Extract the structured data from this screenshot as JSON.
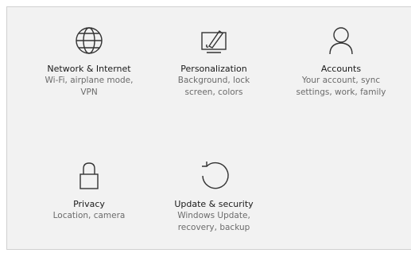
{
  "tiles": [
    {
      "title": "Network & Internet",
      "desc_line1": "Wi-Fi, airplane mode,",
      "desc_line2": "VPN",
      "icon": "globe-icon"
    },
    {
      "title": "Personalization",
      "desc_line1": "Background, lock",
      "desc_line2": "screen, colors",
      "icon": "paint-brush-icon"
    },
    {
      "title": "Accounts",
      "desc_line1": "Your account, sync",
      "desc_line2": "settings, work, family",
      "icon": "person-icon"
    },
    {
      "title": "Privacy",
      "desc_line1": "Location, camera",
      "desc_line2": "",
      "icon": "lock-icon"
    },
    {
      "title": "Update & security",
      "desc_line1": "Windows Update,",
      "desc_line2": "recovery, backup",
      "icon": "refresh-icon"
    }
  ],
  "colors": {
    "background": "#f2f2f2",
    "title": "#1a1a1a",
    "desc": "#6b6b6b",
    "icon_stroke": "#333333"
  }
}
